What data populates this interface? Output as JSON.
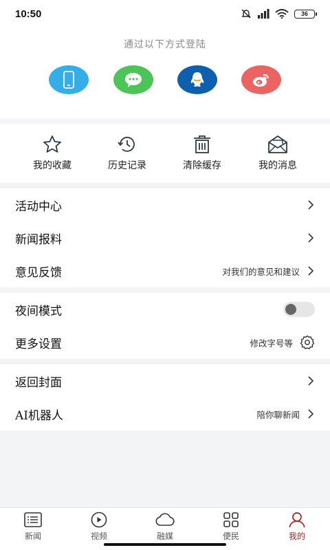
{
  "status": {
    "time": "10:50",
    "battery": "36"
  },
  "login": {
    "title": "通过以下方式登陆",
    "methods": [
      {
        "icon": "phone-icon",
        "color": "#34aee8"
      },
      {
        "icon": "wechat-icon",
        "color": "#4cc458"
      },
      {
        "icon": "qq-icon",
        "color": "#0e5fae"
      },
      {
        "icon": "weibo-icon",
        "color": "#ea6461"
      }
    ]
  },
  "quick": [
    {
      "label": "我的收藏",
      "icon": "star-icon"
    },
    {
      "label": "历史记录",
      "icon": "history-icon"
    },
    {
      "label": "清除缓存",
      "icon": "trash-icon"
    },
    {
      "label": "我的消息",
      "icon": "mail-icon"
    }
  ],
  "menu": {
    "activity": {
      "title": "活动中心"
    },
    "report": {
      "title": "新闻报料"
    },
    "feedback": {
      "title": "意见反馈",
      "sub": "对我们的意见和建议"
    },
    "night": {
      "title": "夜间模式",
      "enabled": false
    },
    "settings": {
      "title": "更多设置",
      "sub": "修改字号等"
    },
    "cover": {
      "title": "返回封面"
    },
    "ai": {
      "title": "AI机器人",
      "sub": "陪你聊新闻"
    }
  },
  "tabs": [
    {
      "label": "新闻",
      "icon": "news-list-icon"
    },
    {
      "label": "视频",
      "icon": "video-play-icon"
    },
    {
      "label": "融媒",
      "icon": "cloud-icon"
    },
    {
      "label": "便民",
      "icon": "grid-icon"
    },
    {
      "label": "我的",
      "icon": "user-icon",
      "active": true
    }
  ],
  "colors": {
    "accent": "#b02020",
    "icon_stroke": "#2a3a4a"
  }
}
